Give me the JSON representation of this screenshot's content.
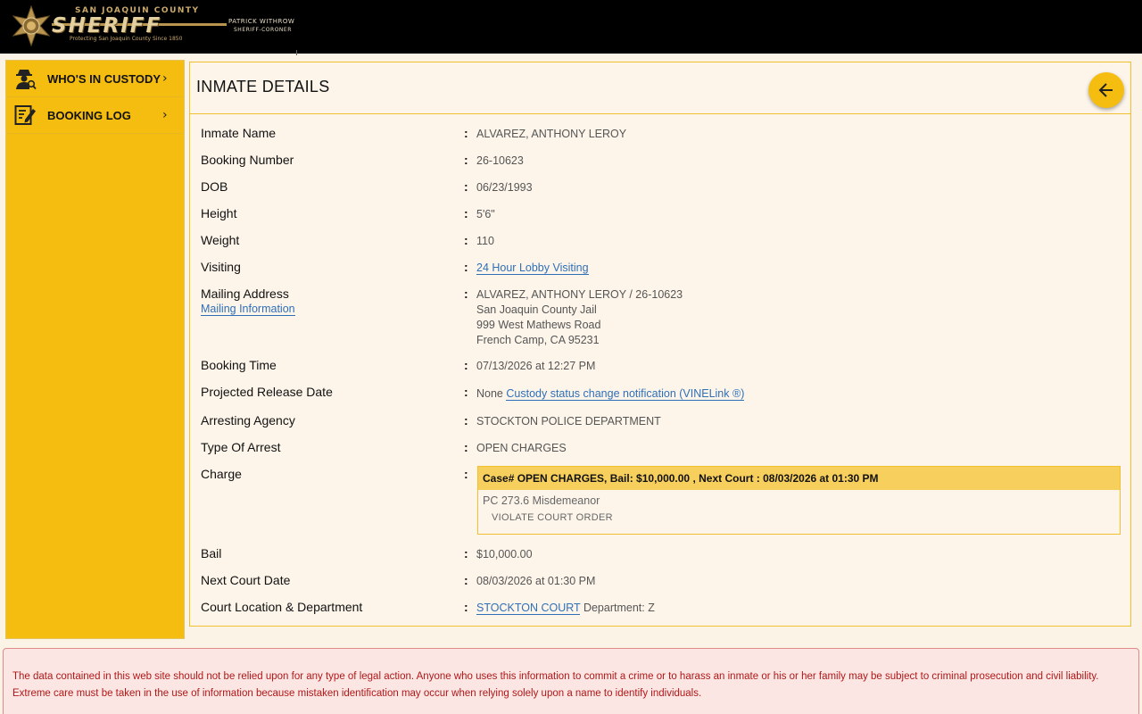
{
  "header": {
    "county": "SAN JOAQUIN COUNTY",
    "brand": "SHERIFF",
    "motto": "Protecting San Joaquin County Since 1850",
    "sheriff_name": "PATRICK WITHROW",
    "sheriff_title": "SHERIFF-CORONER"
  },
  "sidebar": {
    "items": [
      {
        "label": "WHO'S IN CUSTODY",
        "icon": "detective-icon"
      },
      {
        "label": "BOOKING LOG",
        "icon": "notepad-icon"
      }
    ]
  },
  "main": {
    "title": "INMATE DETAILS",
    "fields": {
      "inmate_name": {
        "label": "Inmate Name",
        "value": "ALVAREZ, ANTHONY LEROY"
      },
      "booking_number": {
        "label": "Booking Number",
        "value": "26-10623"
      },
      "dob": {
        "label": "DOB",
        "value": "06/23/1993"
      },
      "height": {
        "label": "Height",
        "value": "5'6\""
      },
      "weight": {
        "label": "Weight",
        "value": "110"
      },
      "visiting": {
        "label": "Visiting",
        "link": "24 Hour Lobby Visiting"
      },
      "mailing": {
        "label": "Mailing Address",
        "link": "Mailing Information",
        "line1": "ALVAREZ, ANTHONY LEROY / 26-10623",
        "line2": "San Joaquin County Jail",
        "line3": "999 West Mathews Road",
        "line4": "French Camp, CA 95231"
      },
      "booking_time": {
        "label": "Booking Time",
        "value": "07/13/2026 at 12:27 PM"
      },
      "release": {
        "label": "Projected Release Date",
        "value": "None",
        "link": "Custody status change notification (VINELink ®)"
      },
      "agency": {
        "label": "Arresting Agency",
        "value": "STOCKTON POLICE DEPARTMENT"
      },
      "arrest_type": {
        "label": "Type Of Arrest",
        "value": "OPEN CHARGES"
      },
      "charge": {
        "label": "Charge",
        "header": "Case# OPEN CHARGES, Bail: $10,000.00 , Next Court : 08/03/2026 at 01:30 PM",
        "code": "PC 273.6 Misdemeanor",
        "description": "VIOLATE COURT ORDER"
      },
      "bail": {
        "label": "Bail",
        "value": "$10,000.00"
      },
      "next_court": {
        "label": "Next Court Date",
        "value": "08/03/2026 at 01:30 PM"
      },
      "court_location": {
        "label": "Court Location & Department",
        "link": "STOCKTON COURT",
        "value": "Department: Z"
      }
    }
  },
  "disclaimer": {
    "line1": "The data contained in this web site should not be relied upon for any type of legal action. Anyone who uses this information to commit a crime or to harass an inmate or his or her family may be subject to criminal prosecution and civil liability.",
    "line2": "Extreme care must be taken in the use of information because mistaken identification may occur when relying solely upon a name to identify individuals."
  },
  "colors": {
    "accent": "#f5bd0f",
    "link": "#2f6fb8",
    "disclaimer_text": "#b01818"
  }
}
